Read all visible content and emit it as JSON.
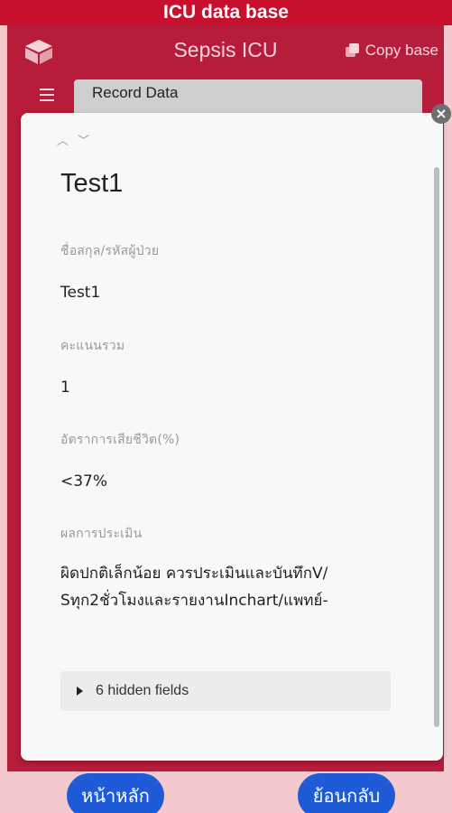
{
  "top_bar": {
    "title": "ICU data base"
  },
  "header": {
    "app_title": "Sepsis ICU",
    "copy_label": "Copy base"
  },
  "tabs": {
    "record_data": "Record Data"
  },
  "card": {
    "close_glyph": "×",
    "record_title": "Test1",
    "fields": [
      {
        "label": "ชื่อสกุล/รหัสผู้ป่วย",
        "value": "Test1"
      },
      {
        "label": "คะแนนรวม",
        "value": "1"
      },
      {
        "label": "อัตราการเสียชีวิต(%)",
        "value": "<37%"
      },
      {
        "label": "ผลการประเมิน",
        "value": "ผิดปกติเล็กน้อย ควรประเมินและบันทึกV/Sทุก2ชั่วโมงและรายงานInchart/แพทย์-"
      }
    ],
    "hidden_fields_label": "6 hidden fields"
  },
  "bottom_nav": {
    "home_label": "หน้าหลัก",
    "back_label": "ย้อนกลับ"
  },
  "colors": {
    "brand_red": "#c8102e",
    "app_bg": "#b71c3a",
    "button_blue": "#1f5bd6"
  }
}
